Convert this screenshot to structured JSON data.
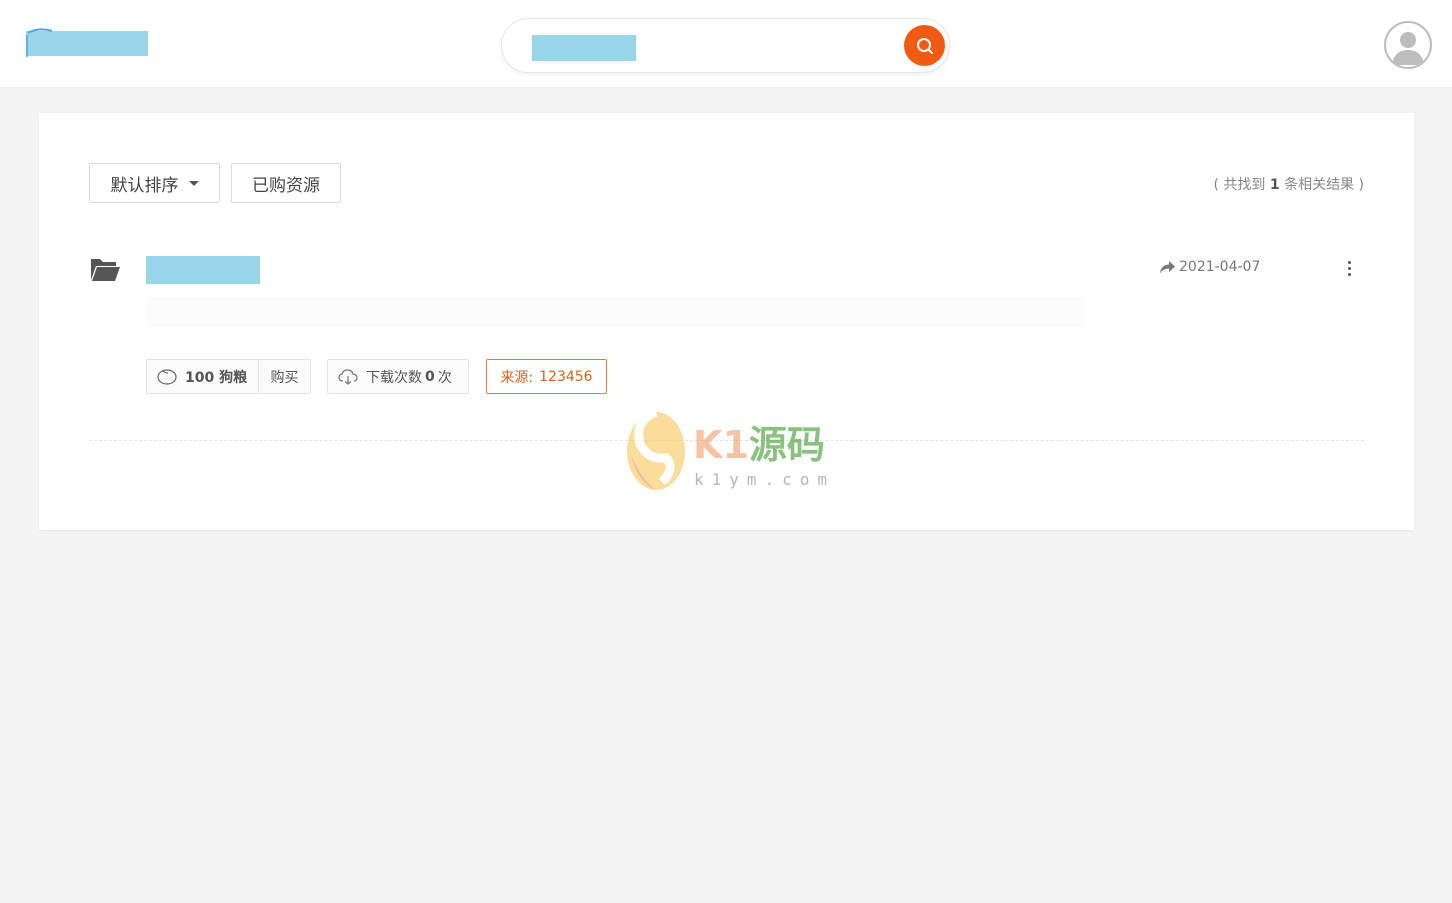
{
  "header": {
    "search": {
      "placeholder": ""
    }
  },
  "toolbar": {
    "sort_label": "默认排序",
    "bought_label": "已购资源",
    "result_prefix": "( 共找到",
    "result_count": "1",
    "result_suffix": "条相关结果 )"
  },
  "items": [
    {
      "date": "2021-04-07",
      "price_value": "100 狗粮",
      "buy_label": "购买",
      "download_prefix": "下载次数",
      "download_count": "0",
      "download_suffix": "次",
      "source_label": "来源:",
      "source_value": "123456"
    }
  ],
  "watermark": {
    "main_a": "K1",
    "main_b": "源码",
    "sub": "k1ym.com"
  },
  "colors": {
    "accent": "#f15a13",
    "redacted_block": "#9ad6ea",
    "source_tag": "#d9641c"
  },
  "icons": [
    "search-icon",
    "user-avatar-icon",
    "folder-icon",
    "share-icon",
    "more-vertical-icon",
    "coin-icon",
    "cloud-download-icon",
    "caret-down-icon"
  ]
}
